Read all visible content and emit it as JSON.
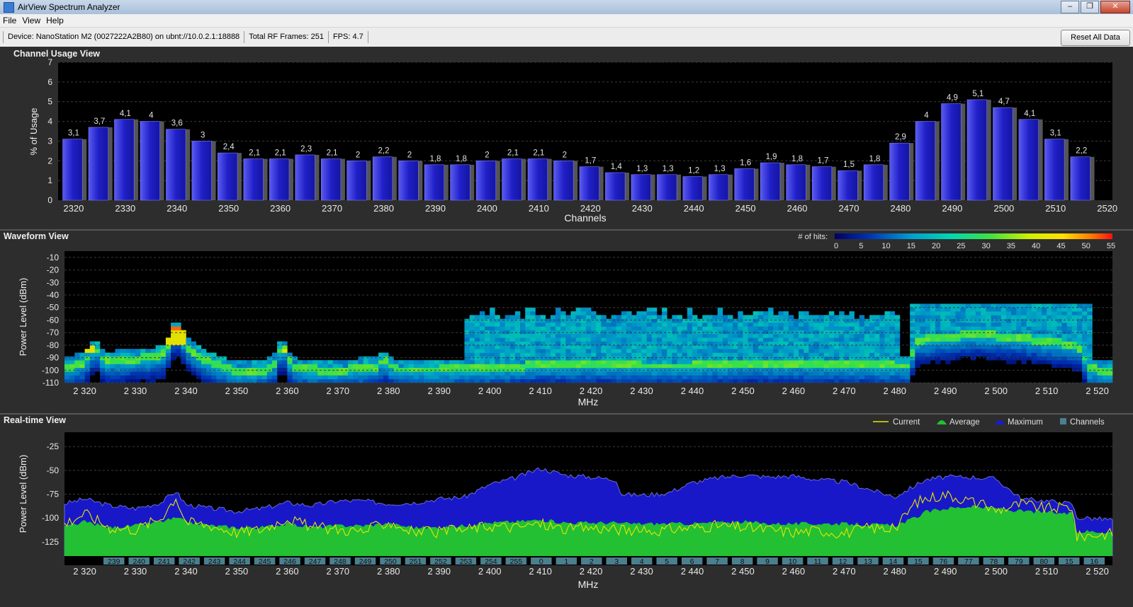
{
  "window": {
    "title": "AirView Spectrum Analyzer",
    "controls": {
      "minimize": "–",
      "maximize": "❐",
      "close": "✕"
    }
  },
  "menu": [
    "File",
    "View",
    "Help"
  ],
  "infobar": {
    "device": "Device: NanoStation M2 (0027222A2B80) on ubnt://10.0.2.1:18888",
    "frames": "Total RF Frames: 251",
    "fps": "FPS: 4.7"
  },
  "reset_label": "Reset All Data",
  "channel_usage": {
    "title": "Channel Usage View",
    "ylabel": "% of Usage",
    "xlabel": "Channels",
    "y_ticks": [
      "0",
      "1",
      "2",
      "3",
      "4",
      "5",
      "6",
      "7"
    ],
    "x_ticks": [
      "2320",
      "2330",
      "2340",
      "2350",
      "2360",
      "2370",
      "2380",
      "2390",
      "2400",
      "2410",
      "2420",
      "2430",
      "2440",
      "2450",
      "2460",
      "2470",
      "2480",
      "2490",
      "2500",
      "2510",
      "2520"
    ]
  },
  "waveform": {
    "title": "Waveform View",
    "legend_title": "# of hits:",
    "legend_ticks": [
      "0",
      "5",
      "10",
      "15",
      "20",
      "25",
      "30",
      "35",
      "40",
      "45",
      "50",
      "55"
    ],
    "ylabel": "Power Level (dBm)",
    "xlabel": "MHz",
    "y_ticks": [
      "-10",
      "-20",
      "-30",
      "-40",
      "-50",
      "-60",
      "-70",
      "-80",
      "-90",
      "-100",
      "-110"
    ],
    "x_ticks": [
      "2 320",
      "2 330",
      "2 340",
      "2 350",
      "2 360",
      "2 370",
      "2 380",
      "2 390",
      "2 400",
      "2 410",
      "2 420",
      "2 430",
      "2 440",
      "2 450",
      "2 460",
      "2 470",
      "2 480",
      "2 490",
      "2 500",
      "2 510",
      "2 520"
    ]
  },
  "realtime": {
    "title": "Real-time View",
    "legend": [
      {
        "label": "Current",
        "color": "#e6e600"
      },
      {
        "label": "Average",
        "color": "#22c032"
      },
      {
        "label": "Maximum",
        "color": "#1a1ad0"
      },
      {
        "label": "Channels",
        "color": "#4a7f8f"
      }
    ],
    "ylabel": "Power Level (dBm)",
    "xlabel": "MHz",
    "y_ticks": [
      "-25",
      "-50",
      "-75",
      "-100",
      "-125"
    ],
    "x_ticks": [
      "2 320",
      "2 330",
      "2 340",
      "2 350",
      "2 360",
      "2 370",
      "2 380",
      "2 390",
      "2 400",
      "2 410",
      "2 420",
      "2 430",
      "2 440",
      "2 450",
      "2 460",
      "2 470",
      "2 480",
      "2 490",
      "2 500",
      "2 510",
      "2 520"
    ],
    "channel_labels": [
      "239",
      "240",
      "241",
      "242",
      "243",
      "244",
      "245",
      "246",
      "247",
      "248",
      "249",
      "250",
      "251",
      "252",
      "253",
      "254",
      "255",
      "0",
      "1",
      "2",
      "3",
      "4",
      "5",
      "6",
      "7",
      "8",
      "9",
      "10",
      "11",
      "12",
      "13",
      "14",
      "15",
      "76",
      "77",
      "78",
      "79",
      "80",
      "15",
      "16"
    ]
  },
  "chart_data": [
    {
      "type": "bar",
      "title": "Channel Usage View",
      "xlabel": "Channels",
      "ylabel": "% of Usage",
      "ylim": [
        0,
        7
      ],
      "xlim": [
        2317,
        2521
      ],
      "x": [
        2320,
        2325,
        2330,
        2335,
        2340,
        2345,
        2350,
        2355,
        2360,
        2365,
        2370,
        2375,
        2380,
        2385,
        2390,
        2395,
        2400,
        2405,
        2410,
        2415,
        2420,
        2425,
        2430,
        2435,
        2440,
        2445,
        2450,
        2455,
        2460,
        2465,
        2470,
        2475,
        2480,
        2485,
        2490,
        2495,
        2500,
        2505,
        2510,
        2515
      ],
      "values": [
        3.1,
        3.7,
        4.1,
        4,
        3.6,
        3,
        2.4,
        2.1,
        2.1,
        2.3,
        2.1,
        2,
        2.2,
        2,
        1.8,
        1.8,
        2,
        2.1,
        2.1,
        2,
        1.7,
        1.4,
        1.3,
        1.3,
        1.2,
        1.3,
        1.6,
        1.9,
        1.8,
        1.7,
        1.5,
        1.8,
        2.9,
        4,
        4.9,
        5.1,
        4.7,
        4.1,
        3.1,
        2.2
      ],
      "grid": true
    },
    {
      "type": "heatmap",
      "title": "Waveform View",
      "xlabel": "MHz",
      "ylabel": "Power Level (dBm)",
      "xlim": [
        2316,
        2523
      ],
      "ylim": [
        -110,
        -5
      ],
      "colorbar_label": "# of hits:",
      "colorbar_range": [
        0,
        55
      ],
      "peak_traces": [
        {
          "x": [
            2316,
            2320,
            2322,
            2324,
            2328,
            2334,
            2336,
            2338,
            2340,
            2344,
            2350,
            2356,
            2358,
            2359,
            2360,
            2362,
            2370,
            2378,
            2379,
            2380,
            2382,
            2390,
            2400,
            2410,
            2420,
            2430,
            2440,
            2450,
            2460,
            2470,
            2480,
            2483,
            2484,
            2495,
            2500,
            2505,
            2515,
            2517,
            2518,
            2523
          ],
          "y": [
            -100,
            -95,
            -83,
            -95,
            -93,
            -91,
            -87,
            -68,
            -82,
            -94,
            -103,
            -101,
            -95,
            -77,
            -93,
            -100,
            -102,
            -98,
            -92,
            -97,
            -101,
            -101,
            -100,
            -97,
            -97,
            -98,
            -98,
            -96,
            -96,
            -97,
            -98,
            -98,
            -78,
            -73,
            -74,
            -76,
            -81,
            -84,
            -100,
            -103
          ]
        }
      ]
    },
    {
      "type": "area",
      "title": "Real-time View",
      "xlabel": "MHz",
      "ylabel": "Power Level (dBm)",
      "xlim": [
        2316,
        2523
      ],
      "ylim": [
        -140,
        -10
      ],
      "x": [
        2316,
        2320,
        2325,
        2330,
        2335,
        2338,
        2340,
        2345,
        2350,
        2355,
        2360,
        2365,
        2370,
        2375,
        2380,
        2385,
        2390,
        2395,
        2400,
        2405,
        2410,
        2415,
        2420,
        2425,
        2426,
        2430,
        2435,
        2440,
        2445,
        2450,
        2455,
        2460,
        2465,
        2470,
        2475,
        2480,
        2484,
        2486,
        2490,
        2495,
        2500,
        2505,
        2510,
        2515,
        2516,
        2518,
        2523
      ],
      "series": [
        {
          "name": "Maximum",
          "values": [
            -85,
            -80,
            -87,
            -90,
            -84,
            -72,
            -86,
            -90,
            -93,
            -90,
            -84,
            -87,
            -82,
            -82,
            -85,
            -84,
            -80,
            -78,
            -65,
            -58,
            -48,
            -55,
            -57,
            -60,
            -75,
            -76,
            -74,
            -63,
            -58,
            -55,
            -57,
            -56,
            -60,
            -62,
            -70,
            -78,
            -66,
            -60,
            -57,
            -57,
            -59,
            -80,
            -82,
            -85,
            -100,
            -100,
            -102
          ]
        },
        {
          "name": "Average",
          "values": [
            -110,
            -104,
            -110,
            -108,
            -104,
            -100,
            -104,
            -108,
            -110,
            -110,
            -106,
            -110,
            -108,
            -108,
            -106,
            -110,
            -110,
            -108,
            -105,
            -104,
            -102,
            -105,
            -105,
            -105,
            -106,
            -106,
            -106,
            -106,
            -105,
            -104,
            -106,
            -106,
            -106,
            -106,
            -107,
            -108,
            -100,
            -94,
            -90,
            -88,
            -90,
            -93,
            -94,
            -96,
            -115,
            -114,
            -115
          ]
        },
        {
          "name": "Current",
          "values": [
            -106,
            -95,
            -110,
            -112,
            -100,
            -78,
            -104,
            -108,
            -115,
            -112,
            -100,
            -110,
            -112,
            -114,
            -104,
            -115,
            -115,
            -112,
            -108,
            -110,
            -106,
            -112,
            -110,
            -112,
            -112,
            -115,
            -112,
            -110,
            -108,
            -110,
            -112,
            -115,
            -113,
            -116,
            -110,
            -112,
            -84,
            -80,
            -75,
            -82,
            -92,
            -85,
            -90,
            -88,
            -120,
            -118,
            -116
          ]
        }
      ],
      "grid": true
    }
  ]
}
